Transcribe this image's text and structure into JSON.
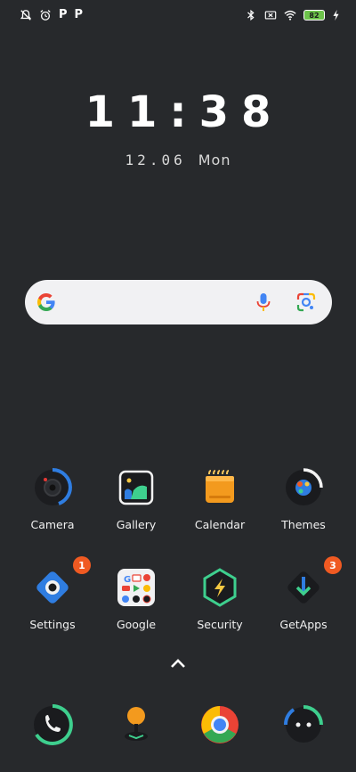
{
  "status_bar": {
    "left_icons": [
      "notifications-off-icon",
      "alarm-icon",
      "p-app-icon",
      "p-app-icon"
    ],
    "p_label_1": "P",
    "p_label_2": "P",
    "right_icons": [
      "bluetooth-icon",
      "sim-none-icon",
      "wifi-icon",
      "battery-icon",
      "charging-icon"
    ],
    "battery_level": "82"
  },
  "clock": {
    "time": "11:38",
    "date_digits": "12.06",
    "weekday": "Mon"
  },
  "search_bar": {
    "icons": [
      "google-g-icon",
      "mic-icon",
      "google-lens-icon"
    ]
  },
  "apps": {
    "row1": [
      {
        "label": "Camera"
      },
      {
        "label": "Gallery"
      },
      {
        "label": "Calendar"
      },
      {
        "label": "Themes"
      }
    ],
    "row2": [
      {
        "label": "Settings",
        "badge": "1"
      },
      {
        "label": "Google"
      },
      {
        "label": "Security"
      },
      {
        "label": "GetApps",
        "badge": "3"
      }
    ]
  },
  "dock": {
    "icons": [
      "phone-icon",
      "messenger-icon",
      "chrome-icon",
      "messages-icon"
    ]
  },
  "colors": {
    "background": "#27292c",
    "badge": "#f05a22",
    "battery": "#6cc24a",
    "search_bar": "#f1f1f3"
  }
}
